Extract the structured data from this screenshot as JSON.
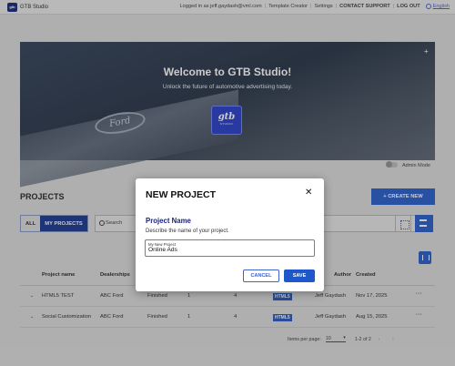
{
  "app": {
    "logo_text": "gtb",
    "brand": "GTB Studio"
  },
  "topnav": {
    "logged_in": "Logged in as jeff.gaydash@vml.com",
    "template_creator": "Template Creator",
    "settings": "Settings",
    "contact_support": "CONTACT SUPPORT",
    "logout": "LOG OUT",
    "language": "English"
  },
  "hero": {
    "title": "Welcome to GTB Studio!",
    "subtitle": "Unlock the future of automotive advertising today.",
    "building_logo": "Ford",
    "tile_logo": "gtb",
    "tile_sub": "STUDIO",
    "corner_icon": "+"
  },
  "admin": {
    "label": "Admin Mode",
    "on": false
  },
  "projects": {
    "title": "PROJECTS",
    "create_label": "+  CREATE NEW",
    "filter_all": "ALL",
    "filter_mine": "MY PROJECTS",
    "search_placeholder": "Search"
  },
  "table": {
    "headers": [
      "Project name",
      "Dealerships",
      "",
      "",
      "",
      "",
      "Author",
      "Created"
    ],
    "rows": [
      {
        "name": "HTML5 TEST",
        "dealership": "ABC Ford",
        "status": "Finished",
        "c1": "1",
        "c2": "4",
        "format": "HTML5",
        "author": "Jeff Gaydash",
        "created": "Nov 17, 2025"
      },
      {
        "name": "Social Customization",
        "dealership": "ABC Ford",
        "status": "Finished",
        "c1": "1",
        "c2": "4",
        "format": "HTML5",
        "author": "Jeff Gaydash",
        "created": "Aug 15, 2025"
      }
    ],
    "row_more": "···",
    "row_toggle": "⌄"
  },
  "pagination": {
    "items_per_page_label": "Items per page:",
    "items_per_page": "10",
    "range": "1-2 of 2",
    "nav": "‹ ›"
  },
  "modal": {
    "title": "NEW PROJECT",
    "close": "✕",
    "label": "Project Name",
    "description": "Describe the name of your project.",
    "field_label": "My New Project",
    "field_value": "Online Ads",
    "cancel": "CANCEL",
    "save": "SAVE"
  }
}
